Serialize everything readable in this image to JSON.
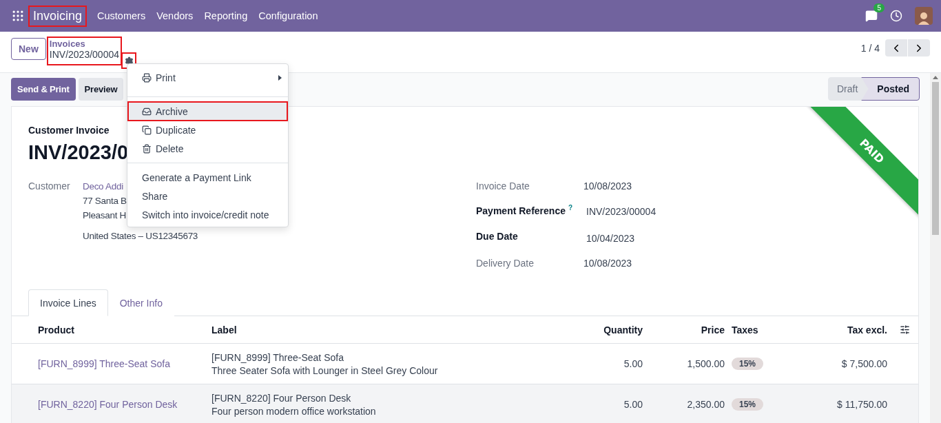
{
  "nav": {
    "app": {
      "label": "Invoicing",
      "annotated": true
    },
    "menu": [
      "Customers",
      "Vendors",
      "Reporting",
      "Configuration"
    ],
    "chat_badge": "5"
  },
  "control_panel": {
    "new_button": "New",
    "breadcrumb": {
      "parent": "Invoices",
      "current": "INV/2023/00004",
      "annotated": true
    },
    "gear": {
      "annotated": true
    },
    "pager": "1 / 4"
  },
  "actions": [
    "Send & Print",
    "Preview"
  ],
  "status": [
    {
      "label": "Draft",
      "selected": false
    },
    {
      "label": "Posted",
      "selected": true
    }
  ],
  "dropdown": {
    "sections": [
      [
        {
          "label": "Print",
          "kind": "print",
          "submenu": true,
          "active": false,
          "annotated": false
        }
      ],
      [
        {
          "label": "Archive",
          "kind": "archive",
          "submenu": false,
          "active": true,
          "annotated": true
        },
        {
          "label": "Duplicate",
          "kind": "duplicate",
          "submenu": false,
          "active": false,
          "annotated": false
        },
        {
          "label": "Delete",
          "kind": "delete",
          "submenu": false,
          "active": false,
          "annotated": false
        }
      ],
      [
        {
          "label": "Generate a Payment Link",
          "kind": "plain",
          "submenu": false,
          "active": false,
          "annotated": false
        },
        {
          "label": "Share",
          "kind": "plain",
          "submenu": false,
          "active": false,
          "annotated": false
        },
        {
          "label": "Switch into invoice/credit note",
          "kind": "plain",
          "submenu": false,
          "active": false,
          "annotated": false
        }
      ]
    ]
  },
  "sheet": {
    "ribbon": "PAID",
    "type": "Customer Invoice",
    "heading": "INV/2023/0",
    "customer": {
      "label": "Customer",
      "name": "Deco Addi",
      "address": [
        "77 Santa B",
        "Pleasant H",
        "United States – US12345673"
      ]
    },
    "fields": [
      {
        "label": "Invoice Date",
        "value": "10/08/2023",
        "bold": false
      },
      {
        "label": "Payment Reference",
        "help": "?",
        "value": "INV/2023/00004",
        "bold": true
      },
      {
        "label": "Due Date",
        "value": "10/04/2023",
        "bold": true
      },
      {
        "label": "Delivery Date",
        "value": "10/08/2023",
        "bold": false
      }
    ],
    "tabs": [
      {
        "label": "Invoice Lines",
        "selected": true
      },
      {
        "label": "Other Info",
        "selected": false
      }
    ],
    "table": {
      "columns": [
        "Product",
        "Label",
        "Quantity",
        "Price",
        "Taxes",
        "Tax excl."
      ],
      "rows": [
        {
          "product": "[FURN_8999] Three-Seat Sofa",
          "label": [
            "[FURN_8999] Three-Seat Sofa",
            "Three Seater Sofa with Lounger in Steel Grey Colour"
          ],
          "quantity": "5.00",
          "price": "1,500.00",
          "taxes": "15%",
          "subtotal": "$ 7,500.00",
          "hovered": false
        },
        {
          "product": "[FURN_8220] Four Person Desk",
          "label": [
            "[FURN_8220] Four Person Desk",
            "Four person modern office workstation"
          ],
          "quantity": "5.00",
          "price": "2,350.00",
          "taxes": "15%",
          "subtotal": "$ 11,750.00",
          "hovered": true
        }
      ]
    }
  }
}
